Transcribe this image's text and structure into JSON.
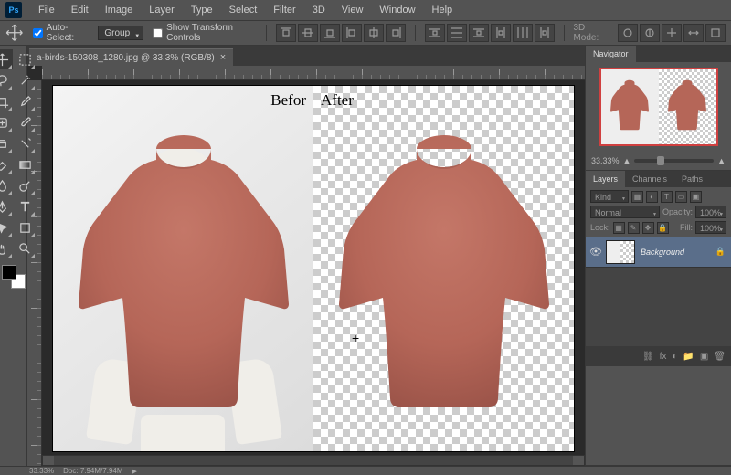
{
  "app": {
    "logo": "Ps"
  },
  "menu": [
    "File",
    "Edit",
    "Image",
    "Layer",
    "Type",
    "Select",
    "Filter",
    "3D",
    "View",
    "Window",
    "Help"
  ],
  "options": {
    "auto_select": "Auto-Select:",
    "group": "Group",
    "show_transform": "Show Transform Controls",
    "mode_label": "3D Mode:"
  },
  "doc": {
    "tab": "a-birds-150308_1280.jpg @ 33.3% (RGB/8)",
    "before_label": "Befor",
    "after_label": "After"
  },
  "navigator": {
    "tab": "Navigator",
    "zoom": "33.33%"
  },
  "layers_panel": {
    "tabs": [
      "Layers",
      "Channels",
      "Paths"
    ],
    "kind": "Kind",
    "blend": "Normal",
    "opacity_label": "Opacity:",
    "opacity": "100%",
    "lock_label": "Lock:",
    "fill_label": "Fill:",
    "fill": "100%",
    "layer_name": "Background"
  },
  "status": {
    "zoom": "33.33%",
    "doc_info": "Doc: 7.94M/7.94M"
  },
  "colors": {
    "shirt": "#b56658",
    "shirt_dark": "#9a5348",
    "shirt_light": "#c47768"
  }
}
